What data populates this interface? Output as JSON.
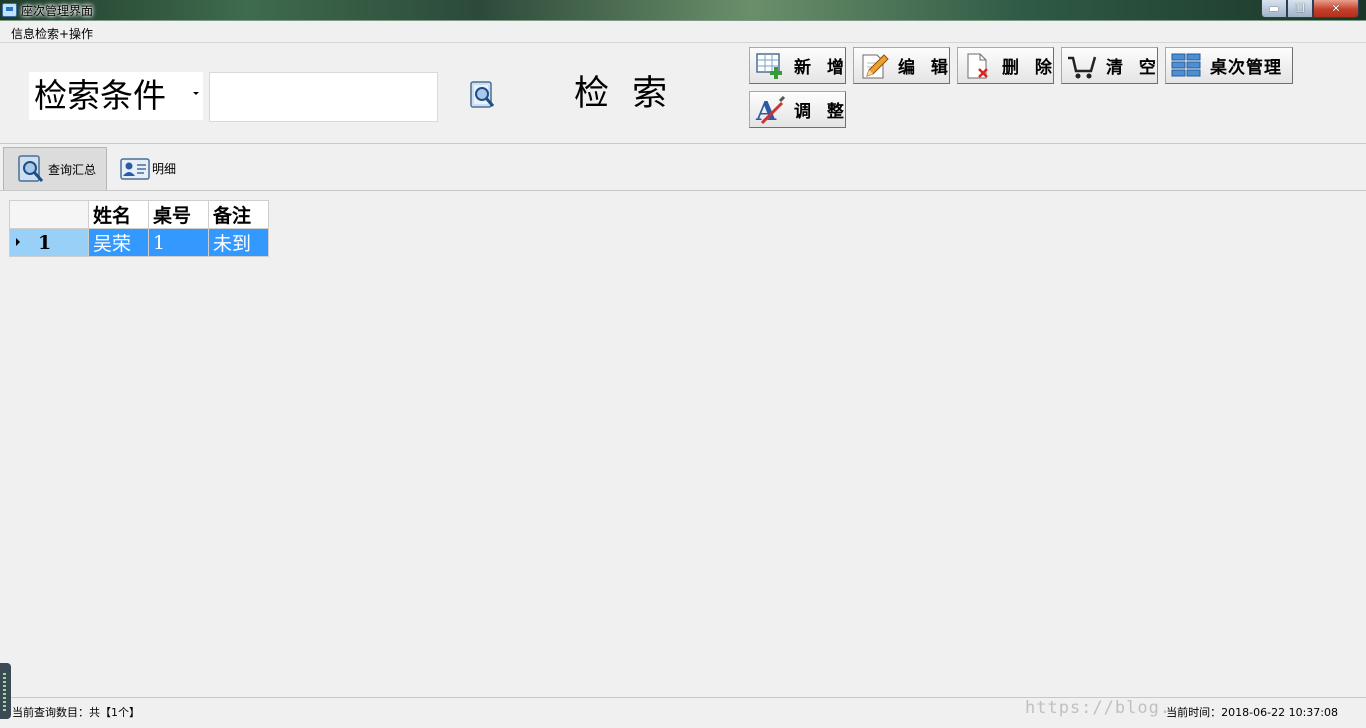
{
  "window": {
    "title": "座次管理界面",
    "min_glyph": "▬",
    "max_glyph": "❐",
    "close_glyph": "✕"
  },
  "menu": {
    "items": [
      {
        "label": "信息检索+操作"
      }
    ]
  },
  "search": {
    "criteria_value": "检索条件",
    "input_value": "",
    "label": "检 索"
  },
  "toolbar": {
    "add_label": "新 增",
    "edit_label": "编 辑",
    "delete_label": "删 除",
    "clear_label": "清 空",
    "table_mgmt_label": "桌次管理",
    "adjust_label": "调 整"
  },
  "tabs": [
    {
      "label": "查询汇总",
      "active": true
    },
    {
      "label": "明细",
      "active": false
    }
  ],
  "grid": {
    "columns": [
      "姓名",
      "桌号",
      "备注"
    ],
    "rows": [
      {
        "index": "1",
        "cells": [
          "吴荣",
          "1",
          "未到"
        ]
      }
    ]
  },
  "status": {
    "count_text": "当前查询数目：共【1个】",
    "time_text": "当前时间：2018-06-22 10:37:08"
  },
  "watermark": "https://blog.",
  "colors": {
    "selection": "#3399ff",
    "row_header_selected": "#99d0f7",
    "close_button": "#c5402a"
  }
}
